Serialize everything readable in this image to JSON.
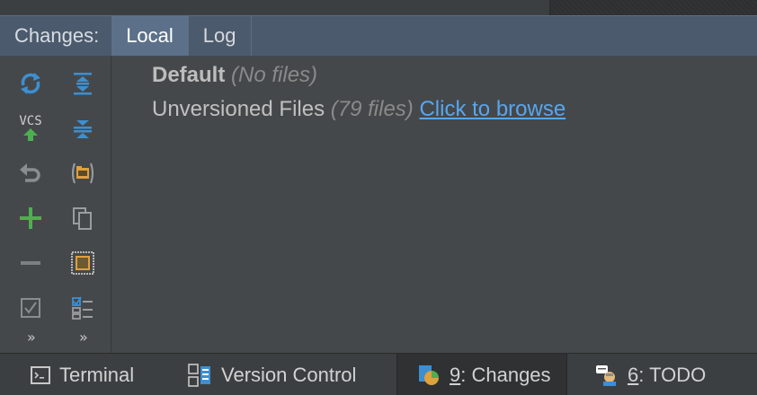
{
  "panel": {
    "title": "Changes:",
    "tabs": [
      {
        "label": "Local",
        "active": true
      },
      {
        "label": "Log",
        "active": false
      }
    ]
  },
  "toolbar": {
    "vcs_label": "VCS",
    "overflow_left": "»",
    "overflow_right": "»",
    "icons_left": [
      "refresh-icon",
      "vcs-commit-icon",
      "rollback-icon",
      "add-icon",
      "remove-icon",
      "checkbox-icon"
    ],
    "icons_right": [
      "expand-all-icon",
      "collapse-all-icon",
      "group-by-directory-icon",
      "copy-icon",
      "show-diff-icon",
      "changelist-icon"
    ]
  },
  "changelists": [
    {
      "name": "Default",
      "meta": "(No files)"
    },
    {
      "name": "Unversioned Files",
      "meta": "(79 files)",
      "link": "Click to browse"
    }
  ],
  "bottom_bar": {
    "tabs": [
      {
        "label": "Terminal",
        "mnemonic": "",
        "active": false
      },
      {
        "label": "Version Control",
        "mnemonic": "",
        "active": false
      },
      {
        "mnemonic": "9",
        "label": ": Changes",
        "active": true
      },
      {
        "mnemonic": "6",
        "label": ": TODO",
        "active": false
      }
    ]
  },
  "colors": {
    "header_bg": "#4b5a6c",
    "active_tab_bg": "#5c7189",
    "panel_bg": "#45484a",
    "link": "#58a6ef",
    "icon_blue": "#3d8fd1",
    "icon_green": "#4caf50",
    "icon_orange": "#e0a03c"
  }
}
